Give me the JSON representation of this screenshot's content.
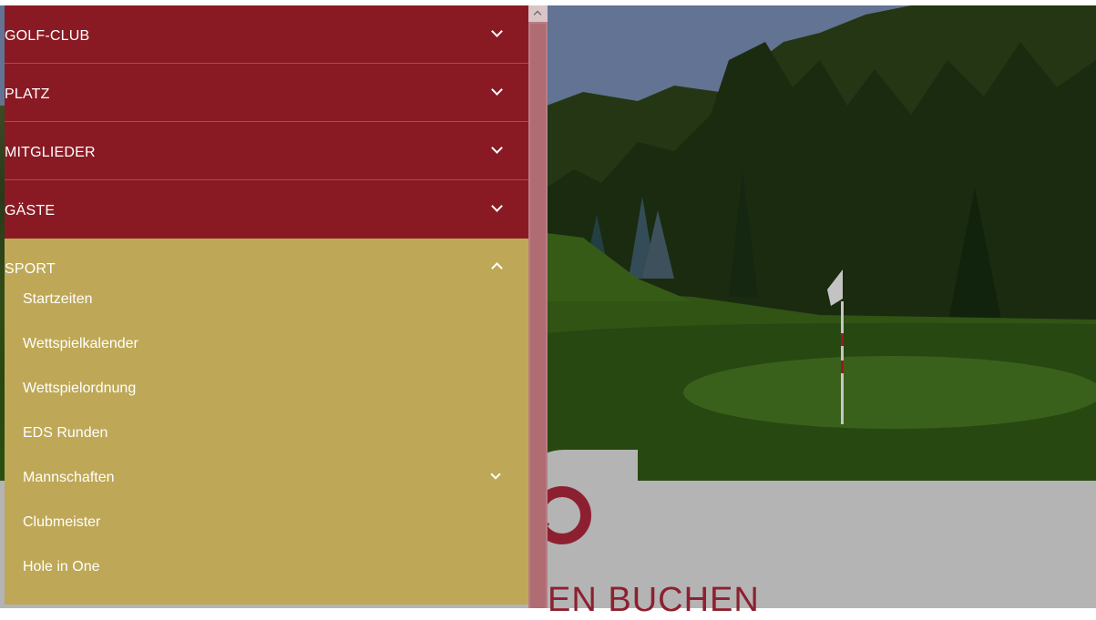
{
  "nav": {
    "items": [
      {
        "label": "GOLF-CLUB",
        "expanded": false
      },
      {
        "label": "PLATZ",
        "expanded": false
      },
      {
        "label": "MITGLIEDER",
        "expanded": false
      },
      {
        "label": "GÄSTE",
        "expanded": false
      }
    ],
    "sport": {
      "label": "SPORT",
      "expanded": true,
      "children": [
        {
          "label": "Startzeiten"
        },
        {
          "label": "Wettspielkalender"
        },
        {
          "label": "Wettspielordnung"
        },
        {
          "label": "EDS Runden"
        },
        {
          "label": "Mannschaften",
          "has_children": true
        },
        {
          "label": "Clubmeister"
        },
        {
          "label": "Hole in One"
        }
      ]
    }
  },
  "page": {
    "booking_heading": "EN BUCHEN"
  },
  "icons": {
    "expand": "chevron-down-icon",
    "collapse": "chevron-up-icon",
    "booking": "search-icon"
  },
  "colors": {
    "nav_primary": "#891a24",
    "nav_active": "#bea857",
    "accent": "#8d2030"
  }
}
